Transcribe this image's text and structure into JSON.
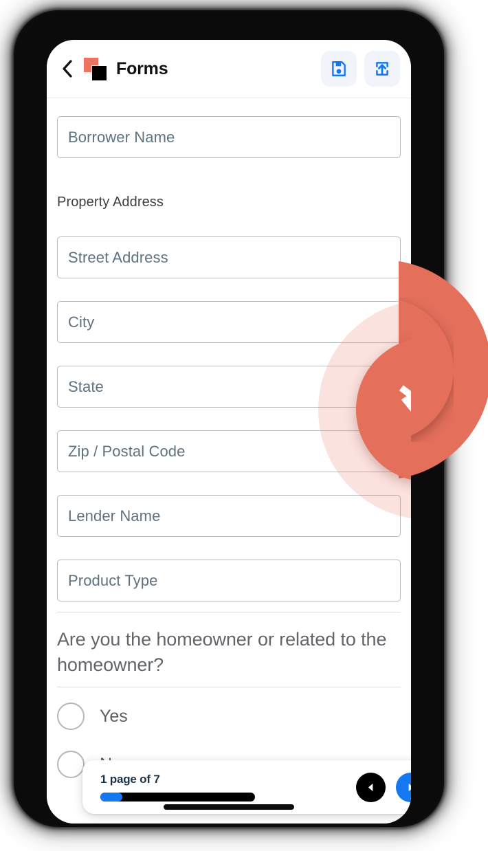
{
  "app": {
    "title": "Forms",
    "back_icon": "chevron-left-icon",
    "logo_icon": "forms-brand-logo",
    "actions": [
      {
        "name": "save",
        "icon": "floppy-disk-save-icon",
        "color": "#1478f0"
      },
      {
        "name": "export",
        "icon": "export-upload-icon",
        "color": "#1478f0"
      }
    ]
  },
  "form": {
    "fields": [
      {
        "name": "borrower-name",
        "placeholder": "Borrower Name",
        "value": ""
      },
      {
        "name": "street-address",
        "placeholder": "Street Address",
        "value": ""
      },
      {
        "name": "city",
        "placeholder": "City",
        "value": ""
      },
      {
        "name": "state",
        "placeholder": "State",
        "value": ""
      },
      {
        "name": "zip-postal-code",
        "placeholder": "Zip / Postal Code",
        "value": ""
      },
      {
        "name": "lender-name",
        "placeholder": "Lender Name",
        "value": ""
      },
      {
        "name": "product-type",
        "placeholder": "Product Type",
        "value": ""
      }
    ],
    "section_label": "Property Address",
    "question": "Are you the homeowner or related to the homeowner?",
    "options": [
      {
        "label": "Yes",
        "selected": false
      },
      {
        "label": "No",
        "selected": false
      }
    ]
  },
  "offline_badge": {
    "icon": "wifi-off-icon",
    "circle_color": "#e4705c",
    "halo_color": "#fbe4df"
  },
  "pagination": {
    "page_text": "1 page of 7",
    "current_page": 1,
    "total_pages": 7,
    "progress_percent": 14,
    "prev_icon": "triangle-left-icon",
    "next_icon": "triangle-right-icon",
    "prev_color": "#000000",
    "next_color": "#1478f0"
  }
}
